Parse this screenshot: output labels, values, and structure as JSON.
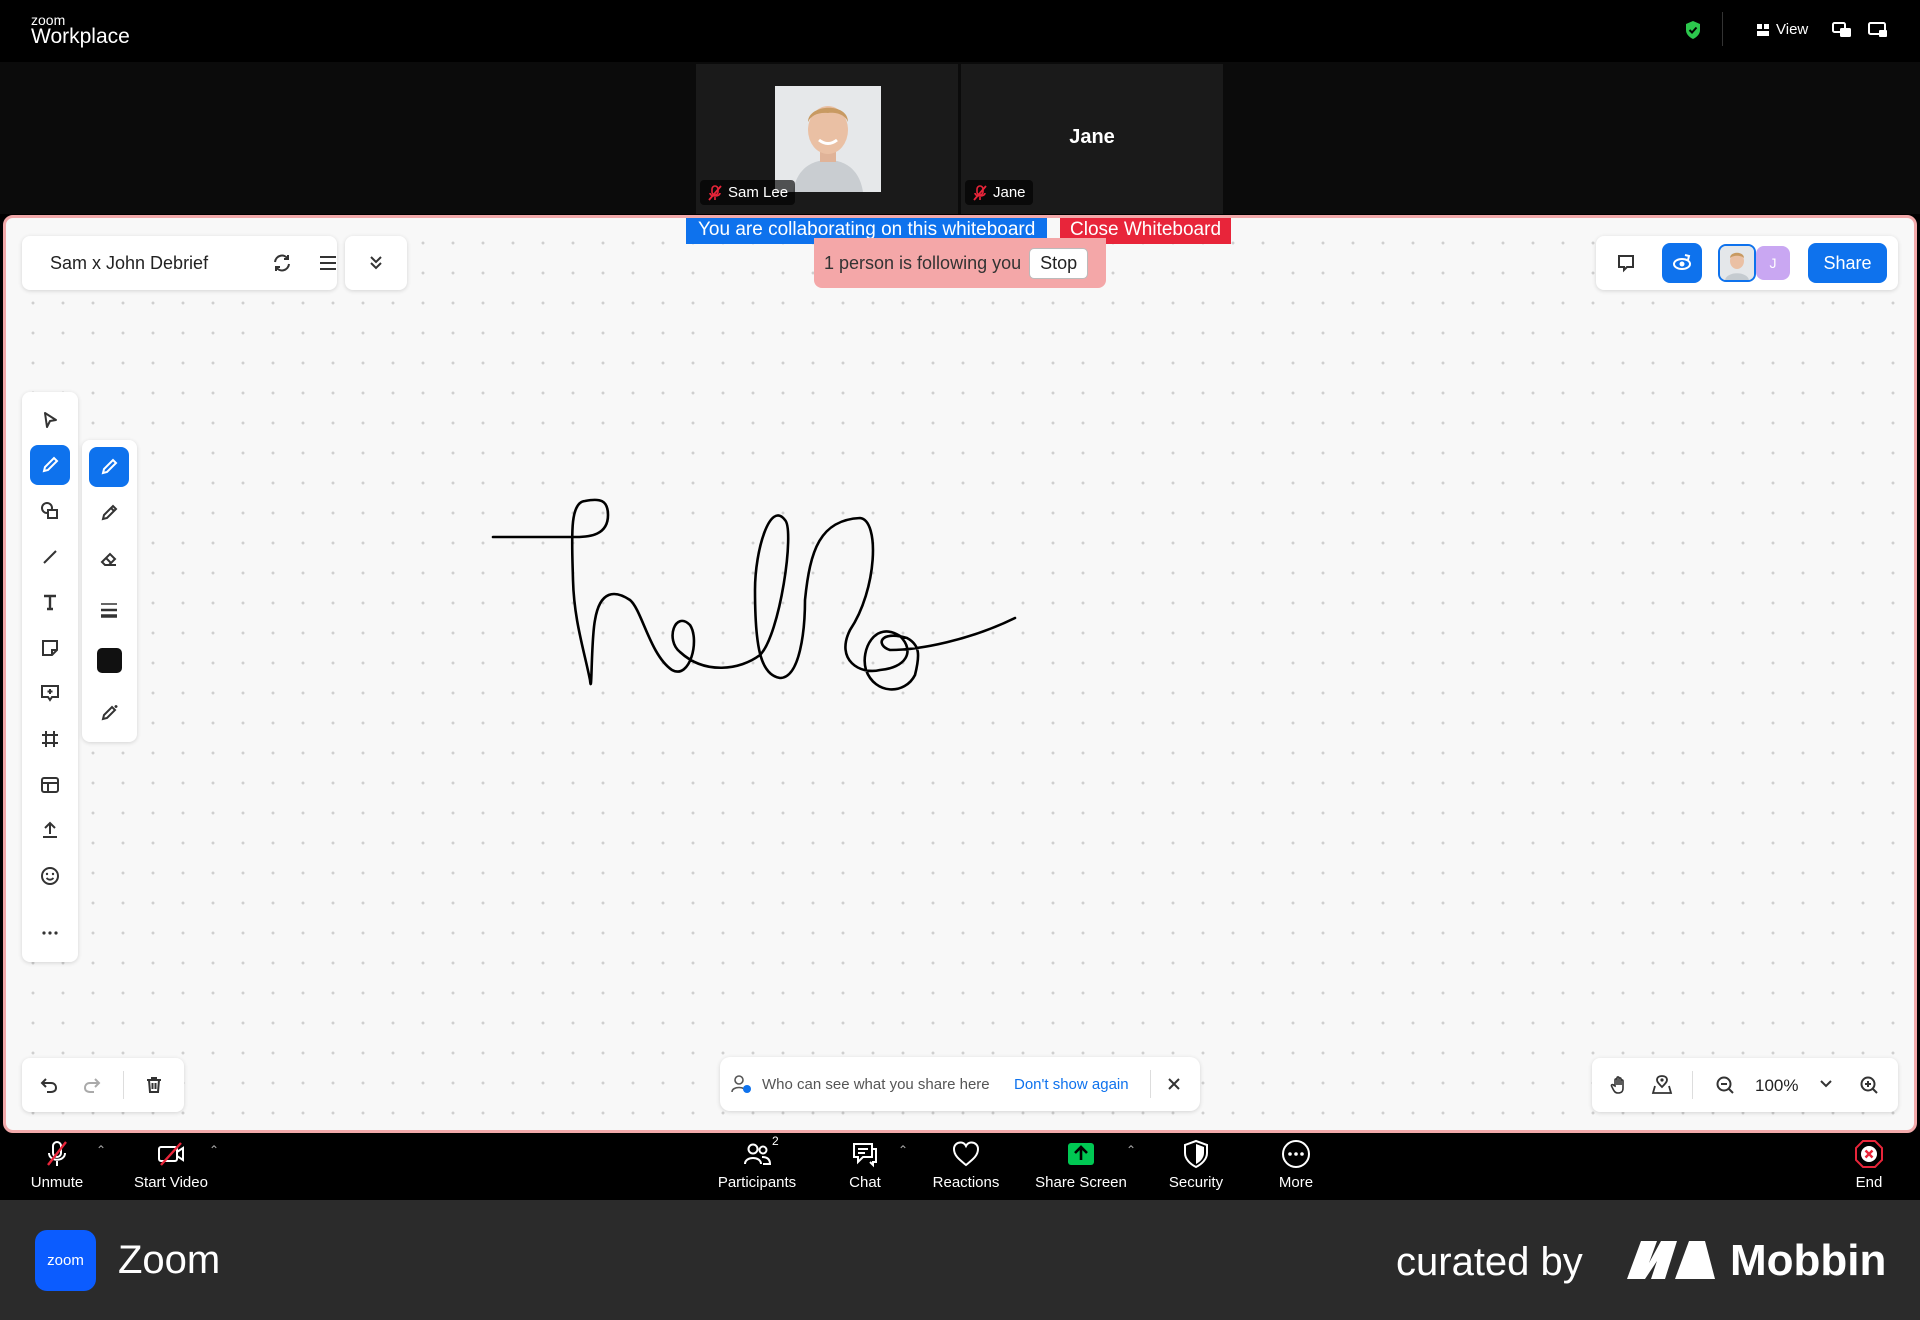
{
  "app": {
    "brand_small": "zoom",
    "brand_big": "Workplace",
    "view_label": "View"
  },
  "participants_tiles": [
    {
      "name": "Sam Lee"
    },
    {
      "name": "Jane",
      "display": "Jane"
    }
  ],
  "whiteboard": {
    "title": "Sam x John Debrief",
    "collab_banner": "You are collaborating on this whiteboard",
    "close_label": "Close Whiteboard",
    "following_text": "1 person is following you",
    "stop_label": "Stop",
    "share_label": "Share",
    "avatar_initial": "J",
    "drawing_text": "hello",
    "info_text": "Who can see what you share here",
    "dont_show_label": "Don't show again",
    "zoom_level": "100%"
  },
  "toolbar": {
    "unmute": "Unmute",
    "start_video": "Start Video",
    "participants": "Participants",
    "participants_count": "2",
    "chat": "Chat",
    "reactions": "Reactions",
    "share_screen": "Share Screen",
    "security": "Security",
    "more": "More",
    "end": "End"
  },
  "footer": {
    "app_name": "Zoom",
    "logo_text": "zoom",
    "curated_by": "curated by",
    "mobbin": "Mobbin"
  },
  "colors": {
    "accent": "#0e72ed",
    "danger": "#e8253a",
    "share_green": "#00c853",
    "border_pink": "#f2a9aa"
  }
}
